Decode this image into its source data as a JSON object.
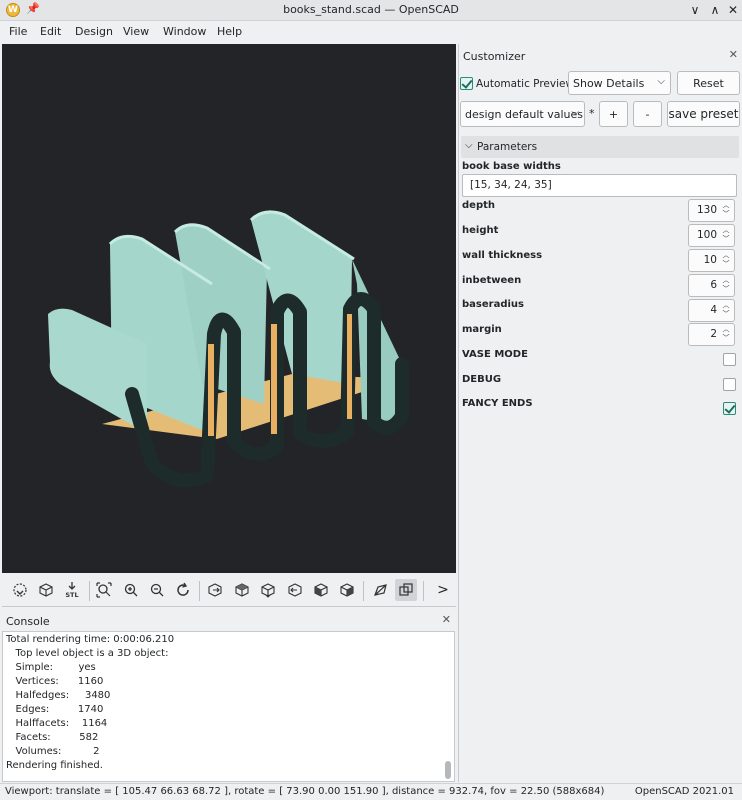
{
  "window": {
    "title": "books_stand.scad — OpenSCAD",
    "app_icon": "openscad-logo-icon",
    "app_icon_letter": "W",
    "pin_icon": "📌",
    "minimize": "∨",
    "maximize": "∧",
    "close": "✕"
  },
  "menu": {
    "items": [
      "File",
      "Edit",
      "Design",
      "View",
      "Window",
      "Help"
    ]
  },
  "viewport": {
    "background": "#232427",
    "model_colors": {
      "teal": "#a5d6cb",
      "outline": "#1b2b2a",
      "base": "#f0c57a"
    }
  },
  "view_toolbar": {
    "stl_label": "STL",
    "next_label": ">",
    "icons": [
      "preview-icon",
      "render-icon",
      "export-stl-icon",
      "view-all-icon",
      "zoom-in-icon",
      "zoom-out-icon",
      "reset-view-icon",
      "view-right-icon",
      "view-top-icon",
      "view-bottom-icon",
      "view-left-icon",
      "view-front-icon",
      "view-back-icon",
      "perspective-icon",
      "orthogonal-icon",
      "more-icon"
    ]
  },
  "console": {
    "title": "Console",
    "close": "✕",
    "lines": [
      "Total rendering time: 0:00:06.210",
      "   Top level object is a 3D object:",
      "   Simple:        yes",
      "   Vertices:      1160",
      "   Halfedges:     3480",
      "   Edges:         1740",
      "   Halffacets:    1164",
      "   Facets:         582",
      "   Volumes:          2",
      "Rendering finished."
    ]
  },
  "status": {
    "left": "Viewport: translate = [ 105.47 66.63 68.72 ], rotate = [ 73.90 0.00 151.90 ], distance = 932.74, fov = 22.50 (588x684)",
    "right": "OpenSCAD 2021.01"
  },
  "customizer": {
    "title": "Customizer",
    "close": "✕",
    "auto_preview_label": "Automatic Preview",
    "auto_preview_checked": true,
    "details_select": "Show Details",
    "reset_label": "Reset",
    "preset_select": "design default values",
    "modified_marker": "*",
    "add_preset": "+",
    "remove_preset": "-",
    "save_preset": "save preset",
    "section_title": "Parameters",
    "params": {
      "book_base_widths": {
        "label": "book base widths",
        "value": "[15, 34, 24, 35]"
      },
      "depth": {
        "label": "depth",
        "value": "130"
      },
      "height": {
        "label": "height",
        "value": "100"
      },
      "wall_thickness": {
        "label": "wall thickness",
        "value": "10"
      },
      "inbetween": {
        "label": "inbetween",
        "value": "6"
      },
      "baseradius": {
        "label": "baseradius",
        "value": "4"
      },
      "margin": {
        "label": "margin",
        "value": "2"
      },
      "vase_mode": {
        "label": "VASE MODE",
        "checked": false
      },
      "debug": {
        "label": "DEBUG",
        "checked": false
      },
      "fancy_ends": {
        "label": "FANCY ENDS",
        "checked": true
      }
    },
    "accent_color": "#2b8a78"
  }
}
